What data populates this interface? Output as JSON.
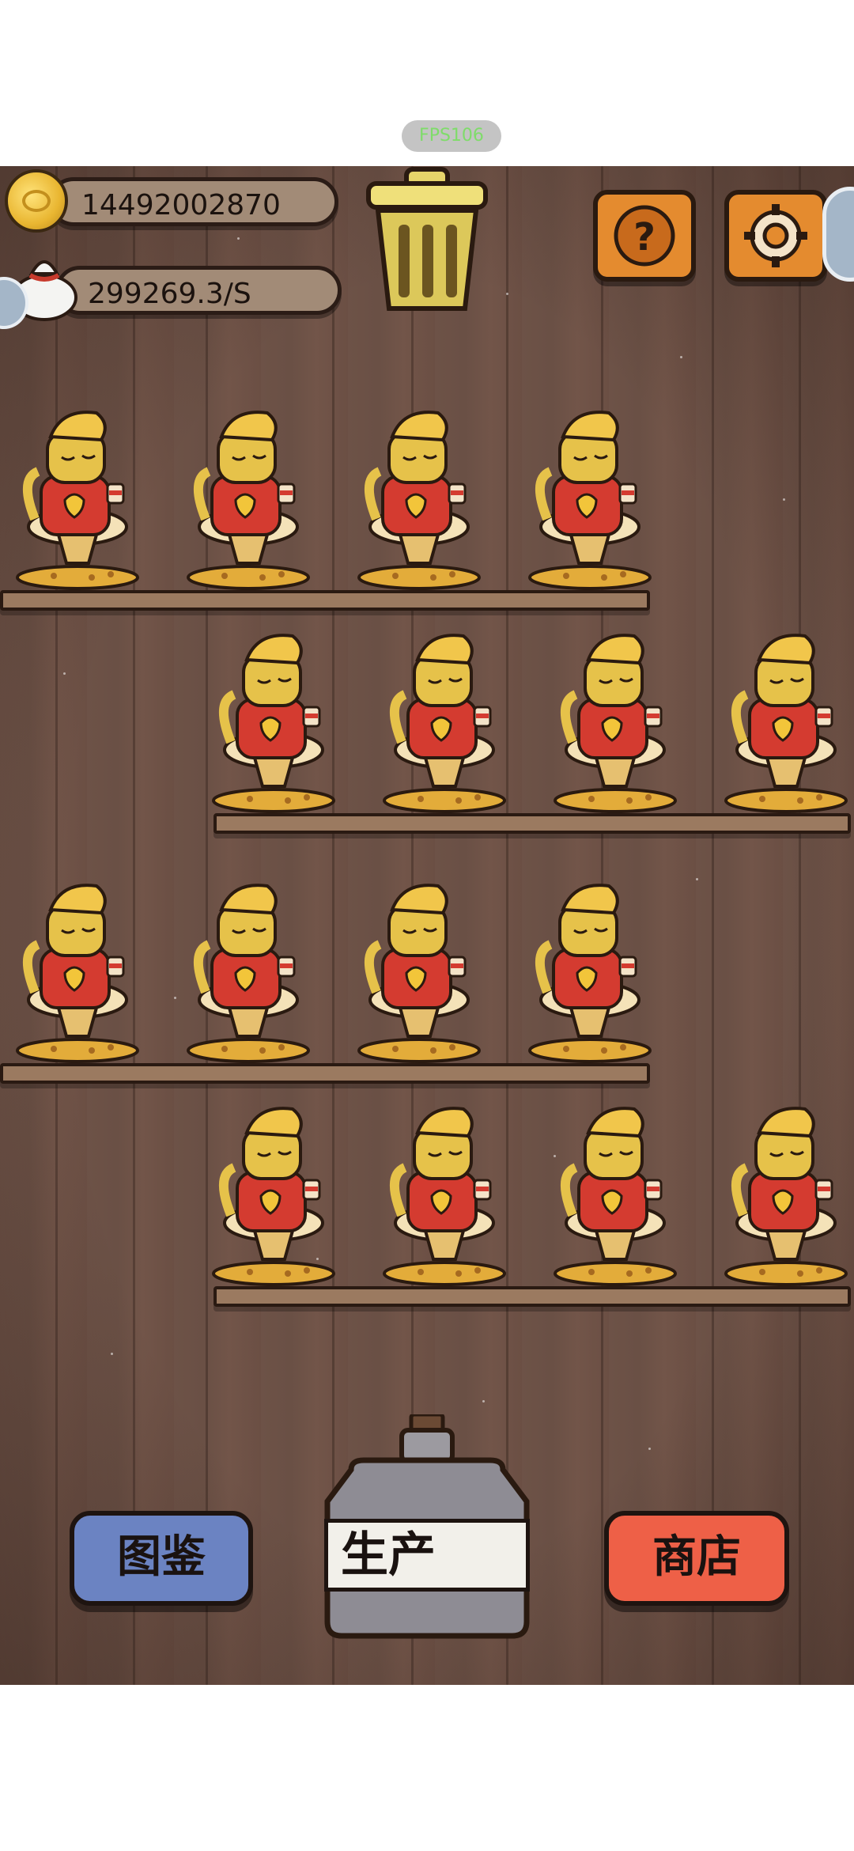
{
  "fps": "FPS106",
  "stats": {
    "coins": "14492002870",
    "income_rate": "299269.3/S"
  },
  "icons": {
    "coin": "coin-icon",
    "bag": "money-bag-icon",
    "trash": "trash-can-icon",
    "help": "question-mark-icon",
    "settings": "gear-icon"
  },
  "bottom_nav": {
    "collection_label": "图鉴",
    "produce_label": "生产",
    "shop_label": "商店"
  },
  "colors": {
    "board": "#6d5247",
    "orange_button": "#e48b2f",
    "blue_button": "#6b83c2",
    "red_button": "#ee6047",
    "cat_body": "#e6c24a",
    "cat_robe": "#d43b30"
  },
  "shelves": [
    {
      "cats": 4
    },
    {
      "cats": 4
    },
    {
      "cats": 4
    },
    {
      "cats": 4
    }
  ]
}
